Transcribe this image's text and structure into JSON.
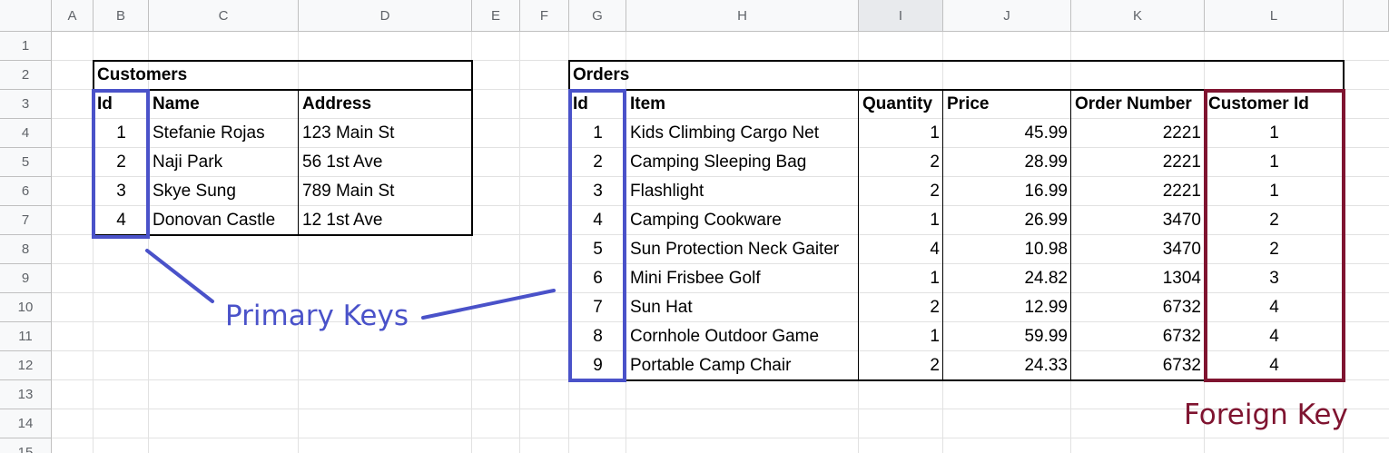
{
  "columns": [
    "A",
    "B",
    "C",
    "D",
    "E",
    "F",
    "G",
    "H",
    "I",
    "J",
    "K",
    "L"
  ],
  "selected_column": "I",
  "rows": [
    "1",
    "2",
    "3",
    "4",
    "5",
    "6",
    "7",
    "8",
    "9",
    "10",
    "11",
    "12",
    "13",
    "14",
    "15"
  ],
  "customers": {
    "title": "Customers",
    "headers": [
      "Id",
      "Name",
      "Address"
    ],
    "rows": [
      [
        "1",
        "Stefanie Rojas",
        "123 Main St"
      ],
      [
        "2",
        "Naji Park",
        "56 1st Ave"
      ],
      [
        "3",
        "Skye Sung",
        "789 Main St"
      ],
      [
        "4",
        "Donovan Castle",
        "12 1st Ave"
      ]
    ]
  },
  "orders": {
    "title": "Orders",
    "headers": [
      "Id",
      "Item",
      "Quantity",
      "Price",
      "Order Number",
      "Customer Id"
    ],
    "rows": [
      [
        "1",
        "Kids Climbing Cargo Net",
        "1",
        "45.99",
        "2221",
        "1"
      ],
      [
        "2",
        "Camping Sleeping Bag",
        "2",
        "28.99",
        "2221",
        "1"
      ],
      [
        "3",
        "Flashlight",
        "2",
        "16.99",
        "2221",
        "1"
      ],
      [
        "4",
        "Camping Cookware",
        "1",
        "26.99",
        "3470",
        "2"
      ],
      [
        "5",
        "Sun Protection Neck Gaiter",
        "4",
        "10.98",
        "3470",
        "2"
      ],
      [
        "6",
        "Mini Frisbee Golf",
        "1",
        "24.82",
        "1304",
        "3"
      ],
      [
        "7",
        "Sun Hat",
        "2",
        "12.99",
        "6732",
        "4"
      ],
      [
        "8",
        "Cornhole Outdoor Game",
        "1",
        "59.99",
        "6732",
        "4"
      ],
      [
        "9",
        "Portable Camp Chair",
        "2",
        "24.33",
        "6732",
        "4"
      ]
    ]
  },
  "annotations": {
    "primary_keys": "Primary Keys",
    "foreign_key": "Foreign Key"
  },
  "colors": {
    "primary_key": "#4a52c9",
    "foreign_key": "#7f1430",
    "header_bg": "#f8f9fa",
    "selected_header_bg": "#e8eaed",
    "gridline": "#e2e2e2"
  }
}
